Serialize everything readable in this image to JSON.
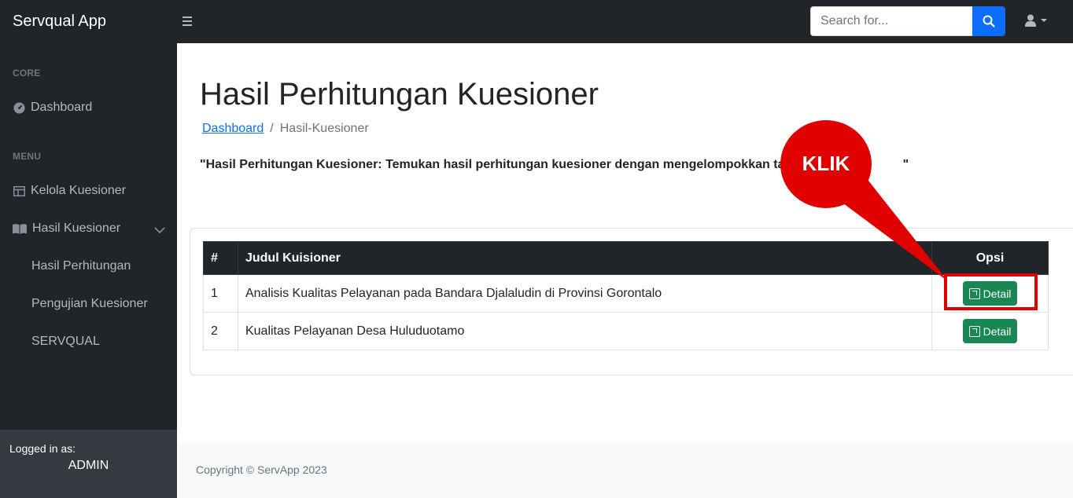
{
  "topnav": {
    "brand": "Servqual App",
    "search_placeholder": "Search for..."
  },
  "sidebar": {
    "heading_core": "CORE",
    "dashboard": "Dashboard",
    "heading_menu": "MENU",
    "kelola": "Kelola Kuesioner",
    "hasil": "Hasil Kuesioner",
    "sub_items": [
      "Hasil Perhitungan",
      "Pengujian Kuesioner",
      "SERVQUAL"
    ],
    "logged_in_label": "Logged in as:",
    "logged_in_user": "ADMIN"
  },
  "main": {
    "title": "Hasil Perhitungan Kuesioner",
    "breadcrumb_link": "Dashboard",
    "breadcrumb_sep": "/",
    "breadcrumb_current": "Hasil-Kuesioner",
    "description": "\"Hasil Perhitungan Kuesioner: Temukan hasil perhitungan kuesioner dengan mengelompokkan tangga",
    "description_tail": "\"",
    "table": {
      "headers": [
        "#",
        "Judul Kuisioner",
        "Opsi"
      ],
      "rows": [
        {
          "no": "1",
          "judul": "Analisis Kualitas Pelayanan pada Bandara Djalaludin di Provinsi Gorontalo",
          "action": "Detail"
        },
        {
          "no": "2",
          "judul": "Kualitas Pelayanan Desa Huluduotamo",
          "action": "Detail"
        }
      ]
    }
  },
  "footer": {
    "copyright": "Copyright © ServApp 2023"
  },
  "annotation": {
    "label": "KLIK",
    "color": "#e00000"
  }
}
